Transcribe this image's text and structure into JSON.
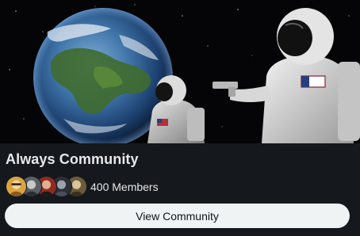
{
  "community": {
    "name": "Always Community",
    "members_label": "400 Members",
    "view_button_label": "View Community"
  },
  "avatars": [
    {
      "name": "avatar-1",
      "color": "#d9a441"
    },
    {
      "name": "avatar-2",
      "color": "#5a5f66"
    },
    {
      "name": "avatar-3",
      "color": "#8e2b22"
    },
    {
      "name": "avatar-4",
      "color": "#2c2f38"
    },
    {
      "name": "avatar-5",
      "color": "#6b5a3c"
    }
  ],
  "banner": {
    "description_icons": [
      "earth-image",
      "astronaut-image",
      "astronaut-with-pistol-image"
    ]
  },
  "colors": {
    "background": "#15181c",
    "text": "#e7e9ea",
    "button_bg": "#eff3f4",
    "button_text": "#0f1419"
  }
}
